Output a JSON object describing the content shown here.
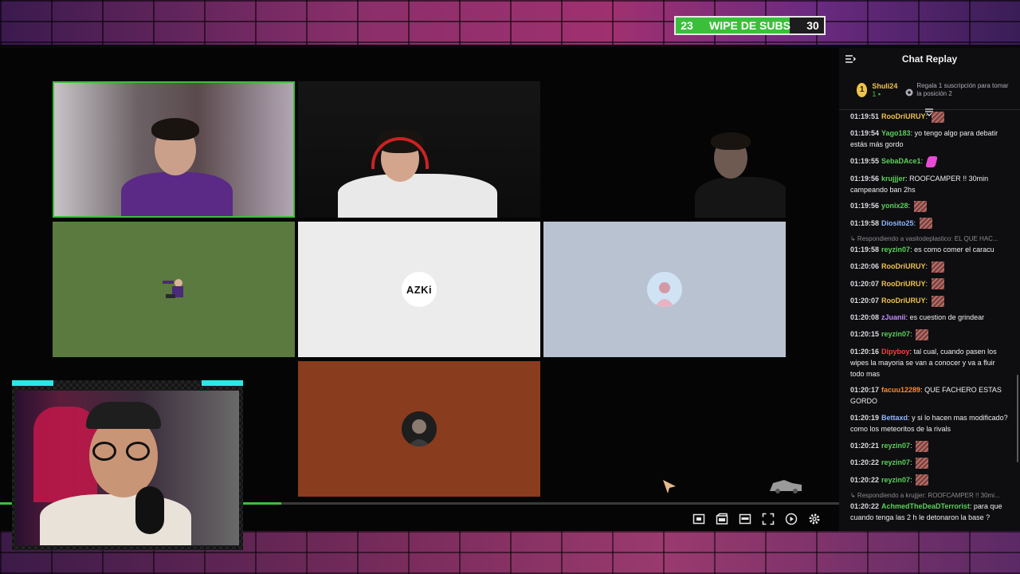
{
  "subs_goal": {
    "current": "23",
    "label": "WIPE DE SUBS",
    "target": "30",
    "progress": 0.77
  },
  "player": {
    "progress": 0.335,
    "tiles": [
      {
        "kind": "camera",
        "color": "#3a3a3a"
      },
      {
        "kind": "camera",
        "color": "#151515"
      },
      {
        "kind": "camera",
        "color": "#050505"
      },
      {
        "kind": "avatar",
        "color": "#5a7a40"
      },
      {
        "kind": "avatar",
        "color": "#ececec",
        "avatar_text": "AZKi"
      },
      {
        "kind": "avatar",
        "color": "#b9c2d1"
      },
      {
        "kind": "avatar",
        "color": "#8a3c1e"
      }
    ],
    "controls": [
      {
        "icon": "miniplayer-icon"
      },
      {
        "icon": "clip-icon"
      },
      {
        "icon": "theater-mode-icon"
      },
      {
        "icon": "fullscreen-icon"
      },
      {
        "icon": "playback-speed-icon"
      },
      {
        "icon": "settings-gear-icon"
      }
    ]
  },
  "chat": {
    "title": "Chat Replay",
    "leaderboard": {
      "rank": "1",
      "user": "Shuli24",
      "count": "1",
      "cta": "Regala 1 suscripción para tomar la posición 2"
    },
    "messages": [
      {
        "time": "01:19:51",
        "user": "RooDriURUY",
        "color": "#f0c24b",
        "text": "",
        "emote": "pixel"
      },
      {
        "time": "01:19:54",
        "user": "Yago183",
        "color": "#5ad15a",
        "text": "yo tengo algo para debatir estás más gordo"
      },
      {
        "time": "01:19:55",
        "user": "SebaDAce1",
        "color": "#5ad15a",
        "text": "",
        "emote": "pink"
      },
      {
        "time": "01:19:56",
        "user": "krujjjer",
        "color": "#5ad15a",
        "text": "ROOFCAMPER !! 30min campeando ban 2hs"
      },
      {
        "time": "01:19:56",
        "user": "yonix28",
        "color": "#5ad15a",
        "text": "",
        "emote": "pixel"
      },
      {
        "time": "01:19:58",
        "user": "Diosito25",
        "color": "#8fb6ff",
        "text": "",
        "emote": "pixel"
      },
      {
        "reply": "Respondiendo a vasitodeplastico: EL QUE HAC...",
        "time": "01:19:58",
        "user": "reyzin07",
        "color": "#5ad15a",
        "text": "es como comer el caracu"
      },
      {
        "time": "01:20:06",
        "user": "RooDriURUY",
        "color": "#f0c24b",
        "text": "",
        "emote": "pixel"
      },
      {
        "time": "01:20:07",
        "user": "RooDriURUY",
        "color": "#f0c24b",
        "text": "",
        "emote": "pixel"
      },
      {
        "time": "01:20:07",
        "user": "RooDriURUY",
        "color": "#f0c24b",
        "text": "",
        "emote": "pixel"
      },
      {
        "time": "01:20:08",
        "user": "zJuanii",
        "color": "#c58cff",
        "text": "es cuestion de grindear"
      },
      {
        "time": "01:20:15",
        "user": "reyzin07",
        "color": "#5ad15a",
        "text": "",
        "emote": "pixel"
      },
      {
        "time": "01:20:16",
        "user": "Dipyboy",
        "color": "#ff3b3b",
        "text": "tal cual, cuando pasen los wipes la mayoria se van a conocer y va a fluir todo mas"
      },
      {
        "time": "01:20:17",
        "user": "facuu12289",
        "color": "#ff8a2a",
        "text": "QUE FACHERO ESTAS GORDO"
      },
      {
        "time": "01:20:19",
        "user": "Bettaxd",
        "color": "#8fb6ff",
        "text": "y si lo hacen mas modificado? como los meteoritos de la rivals"
      },
      {
        "time": "01:20:21",
        "user": "reyzin07",
        "color": "#5ad15a",
        "text": "",
        "emote": "pixel"
      },
      {
        "time": "01:20:22",
        "user": "reyzin07",
        "color": "#5ad15a",
        "text": "",
        "emote": "pixel"
      },
      {
        "time": "01:20:22",
        "user": "reyzin07",
        "color": "#5ad15a",
        "text": "",
        "emote": "pixel"
      },
      {
        "reply": "Respondiendo a krujjjer: ROOFCAMPER !! 30mi...",
        "time": "01:20:22",
        "user": "AchmedTheDeaDTerrorist",
        "color": "#5ad15a",
        "text": "para que cuando tenga las 2 h le detonaron la base ?"
      }
    ]
  }
}
